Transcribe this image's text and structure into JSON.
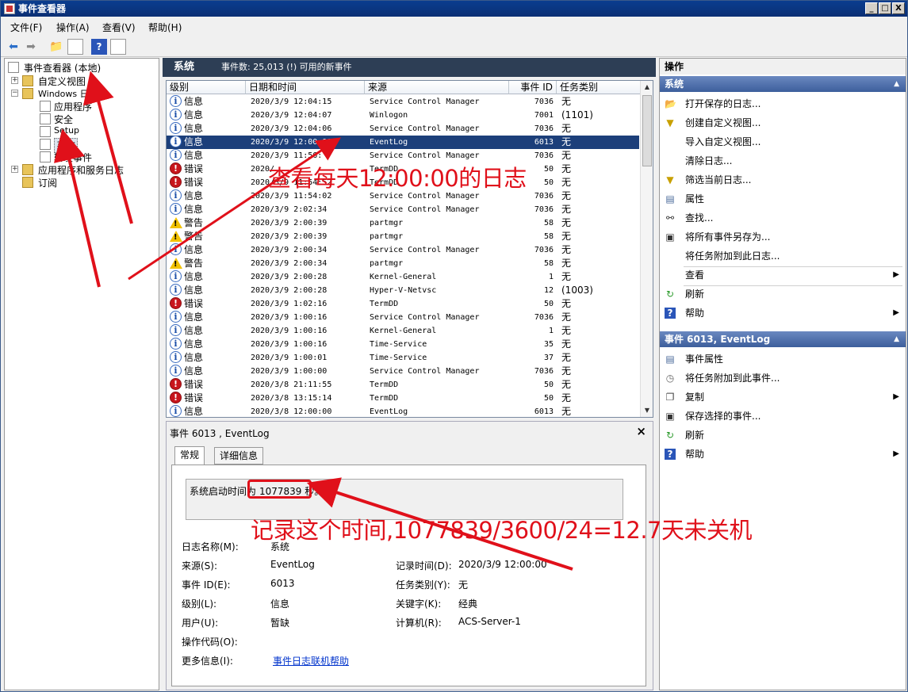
{
  "window": {
    "title": "事件查看器",
    "min": "_",
    "max": "□",
    "close": "X"
  },
  "menu": [
    "文件(F)",
    "操作(A)",
    "查看(V)",
    "帮助(H)"
  ],
  "toolbar": {
    "icons": [
      "back-icon",
      "forward-icon",
      "up-folder-icon",
      "show-hide-tree-icon",
      "help-icon",
      "properties-icon"
    ]
  },
  "tree": {
    "root": "事件查看器 (本地)",
    "custom_views": "自定义视图",
    "windows_logs": "Windows 日志",
    "application": "应用程序",
    "security": "安全",
    "setup": "Setup",
    "system": "系统",
    "forwarded": "转发事件",
    "app_services": "应用程序和服务日志",
    "subscriptions": "订阅"
  },
  "center": {
    "title": "系统",
    "count": "事件数: 25,013 (!) 可用的新事件"
  },
  "columns": [
    "级别",
    "日期和时间",
    "来源",
    "事件 ID",
    "任务类别"
  ],
  "events": [
    {
      "level": "信息",
      "type": "info",
      "time": "2020/3/9 12:04:15",
      "source": "Service Control Manager",
      "id": "7036",
      "cat": "无"
    },
    {
      "level": "信息",
      "type": "info",
      "time": "2020/3/9 12:04:07",
      "source": "Winlogon",
      "id": "7001",
      "cat": "(1101)"
    },
    {
      "level": "信息",
      "type": "info",
      "time": "2020/3/9 12:04:06",
      "source": "Service Control Manager",
      "id": "7036",
      "cat": "无"
    },
    {
      "level": "信息",
      "type": "info",
      "time": "2020/3/9 12:00:00",
      "source": "EventLog",
      "id": "6013",
      "cat": "无",
      "selected": true
    },
    {
      "level": "信息",
      "type": "info",
      "time": "2020/3/9 11:56:",
      "source": "Service Control Manager",
      "id": "7036",
      "cat": "无"
    },
    {
      "level": "错误",
      "type": "err",
      "time": "2020/",
      "source": "TermDD",
      "id": "50",
      "cat": "无"
    },
    {
      "level": "错误",
      "type": "err",
      "time": "2020/3/9 11:54:52",
      "source": "TermDD",
      "id": "50",
      "cat": "无"
    },
    {
      "level": "信息",
      "type": "info",
      "time": "2020/3/9 11:54:02",
      "source": "Service Control Manager",
      "id": "7036",
      "cat": "无"
    },
    {
      "level": "信息",
      "type": "info",
      "time": "2020/3/9 2:02:34",
      "source": "Service Control Manager",
      "id": "7036",
      "cat": "无"
    },
    {
      "level": "警告",
      "type": "warn",
      "time": "2020/3/9 2:00:39",
      "source": "partmgr",
      "id": "58",
      "cat": "无"
    },
    {
      "level": "警告",
      "type": "warn",
      "time": "2020/3/9 2:00:39",
      "source": "partmgr",
      "id": "58",
      "cat": "无"
    },
    {
      "level": "信息",
      "type": "info",
      "time": "2020/3/9 2:00:34",
      "source": "Service Control Manager",
      "id": "7036",
      "cat": "无"
    },
    {
      "level": "警告",
      "type": "warn",
      "time": "2020/3/9 2:00:34",
      "source": "partmgr",
      "id": "58",
      "cat": "无"
    },
    {
      "level": "信息",
      "type": "info",
      "time": "2020/3/9 2:00:28",
      "source": "Kernel-General",
      "id": "1",
      "cat": "无"
    },
    {
      "level": "信息",
      "type": "info",
      "time": "2020/3/9 2:00:28",
      "source": "Hyper-V-Netvsc",
      "id": "12",
      "cat": "(1003)"
    },
    {
      "level": "错误",
      "type": "err",
      "time": "2020/3/9 1:02:16",
      "source": "TermDD",
      "id": "50",
      "cat": "无"
    },
    {
      "level": "信息",
      "type": "info",
      "time": "2020/3/9 1:00:16",
      "source": "Service Control Manager",
      "id": "7036",
      "cat": "无"
    },
    {
      "level": "信息",
      "type": "info",
      "time": "2020/3/9 1:00:16",
      "source": "Kernel-General",
      "id": "1",
      "cat": "无"
    },
    {
      "level": "信息",
      "type": "info",
      "time": "2020/3/9 1:00:16",
      "source": "Time-Service",
      "id": "35",
      "cat": "无"
    },
    {
      "level": "信息",
      "type": "info",
      "time": "2020/3/9 1:00:01",
      "source": "Time-Service",
      "id": "37",
      "cat": "无"
    },
    {
      "level": "信息",
      "type": "info",
      "time": "2020/3/9 1:00:00",
      "source": "Service Control Manager",
      "id": "7036",
      "cat": "无"
    },
    {
      "level": "错误",
      "type": "err",
      "time": "2020/3/8 21:11:55",
      "source": "TermDD",
      "id": "50",
      "cat": "无"
    },
    {
      "level": "错误",
      "type": "err",
      "time": "2020/3/8 13:15:14",
      "source": "TermDD",
      "id": "50",
      "cat": "无"
    },
    {
      "level": "信息",
      "type": "info",
      "time": "2020/3/8 12:00:00",
      "source": "EventLog",
      "id": "6013",
      "cat": "无"
    }
  ],
  "detail": {
    "title": "事件 6013 , EventLog",
    "close": "×",
    "tab_general": "常规",
    "tab_details": "详细信息",
    "desc_prefix": "系统启动时间为",
    "desc_value": "1077839 秒。",
    "log_name_label": "日志名称(M):",
    "log_name": "系统",
    "source_label": "来源(S):",
    "source": "EventLog",
    "logged_label": "记录时间(D):",
    "logged": "2020/3/9 12:00:00",
    "event_id_label": "事件 ID(E):",
    "event_id": "6013",
    "task_label": "任务类别(Y):",
    "task": "无",
    "level_label": "级别(L):",
    "level": "信息",
    "keywords_label": "关键字(K):",
    "keywords": "经典",
    "user_label": "用户(U):",
    "user": "暂缺",
    "computer_label": "计算机(R):",
    "computer": "ACS-Server-1",
    "opcode_label": "操作代码(O):",
    "more_label": "更多信息(I):",
    "more_link": "事件日志联机帮助"
  },
  "actions": {
    "header": "操作",
    "section1": "系统",
    "items1": [
      {
        "label": "打开保存的日志...",
        "icon": "open-folder-icon"
      },
      {
        "label": "创建自定义视图...",
        "icon": "filter-icon"
      },
      {
        "label": "导入自定义视图...",
        "icon": ""
      },
      {
        "label": "清除日志...",
        "icon": ""
      },
      {
        "label": "筛选当前日志...",
        "icon": "filter-icon"
      },
      {
        "label": "属性",
        "icon": "properties-icon"
      },
      {
        "label": "查找...",
        "icon": "binoculars-icon"
      },
      {
        "label": "将所有事件另存为...",
        "icon": "save-icon"
      },
      {
        "label": "将任务附加到此日志...",
        "icon": ""
      },
      {
        "label": "查看",
        "icon": "",
        "arrow": true
      },
      {
        "label": "刷新",
        "icon": "refresh-icon"
      },
      {
        "label": "帮助",
        "icon": "help-icon",
        "arrow": true
      }
    ],
    "section2": "事件 6013, EventLog",
    "items2": [
      {
        "label": "事件属性",
        "icon": "properties-icon"
      },
      {
        "label": "将任务附加到此事件...",
        "icon": "task-icon"
      },
      {
        "label": "复制",
        "icon": "copy-icon",
        "arrow": true
      },
      {
        "label": "保存选择的事件...",
        "icon": "save-icon"
      },
      {
        "label": "刷新",
        "icon": "refresh-icon"
      },
      {
        "label": "帮助",
        "icon": "help-icon",
        "arrow": true
      }
    ]
  },
  "annotations": {
    "note1": "查看每天12:00:00的日志",
    "note2": "记录这个时间,1077839/3600/24=12.7天未关机"
  },
  "colors": {
    "annotation": "#e0101a",
    "selection": "#1c3f7a",
    "header": "#2d3e55"
  }
}
